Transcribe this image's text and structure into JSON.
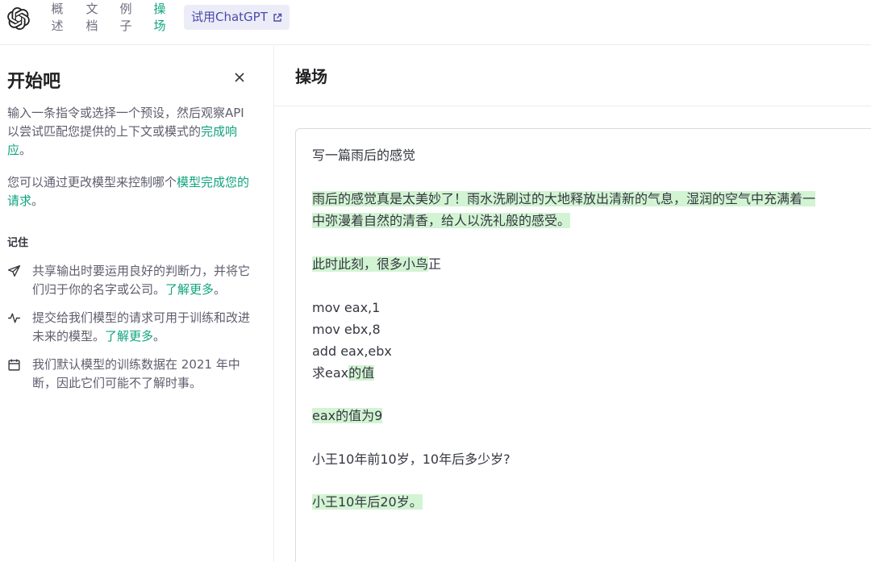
{
  "nav": {
    "items": [
      {
        "top": "概",
        "bottom": "述"
      },
      {
        "top": "文",
        "bottom": "档"
      },
      {
        "top": "例",
        "bottom": "子"
      },
      {
        "top": "操",
        "bottom": "场"
      }
    ],
    "try_button": "试用ChatGPT",
    "accent": "#10a37f"
  },
  "sidebar": {
    "title": "开始吧",
    "para1": {
      "text": "输入一条指令或选择一个预设，然后观察API 以尝试匹配您提供的上下文或模式的",
      "link": "完成响应",
      "end": "。"
    },
    "para2": {
      "text": "您可以通过更改模型来控制哪个",
      "link": "模型完成您的请求",
      "end": "。"
    },
    "remember": "记住",
    "notes": [
      {
        "icon": "send-icon",
        "text": "共享输出时要运用良好的判断力，并将它们归于你的名字或公司。",
        "link": "了解更多",
        "end": "。"
      },
      {
        "icon": "activity-icon",
        "text": "提交给我们模型的请求可用于训练和改进未来的模型。",
        "link": "了解更多",
        "end": "。"
      },
      {
        "icon": "calendar-icon",
        "text": "我们默认模型的训练数据在 2021 年中断，因此它们可能不了解时事。",
        "link": "",
        "end": ""
      }
    ]
  },
  "main": {
    "title": "操场",
    "editor_lines": [
      {
        "text": "写一篇雨后的感觉",
        "hl": ""
      },
      {
        "text": "",
        "hl": "雨后的感觉真是太美妙了！雨水洗刷过的大地释放出清新的气息，湿润的空气中充满着一"
      },
      {
        "text": "",
        "hl": "中弥漫着自然的清香，给人以洗礼般的感受。"
      },
      {
        "text": "",
        "hl": "此时此刻，很多小鸟",
        "plain_after": "正"
      },
      {
        "text": "mov eax,1",
        "hl": ""
      },
      {
        "text": "mov ebx,8",
        "hl": ""
      },
      {
        "text": "add eax,ebx",
        "hl": ""
      },
      {
        "text": "求eax",
        "hl": "的值"
      },
      {
        "text": "",
        "hl": "eax的值为9"
      },
      {
        "text": "小王10年前10岁，10年后多少岁?",
        "hl": ""
      },
      {
        "text": "",
        "hl": "小王10年后20岁。"
      }
    ],
    "highlight_color": "#d2f4d3"
  }
}
